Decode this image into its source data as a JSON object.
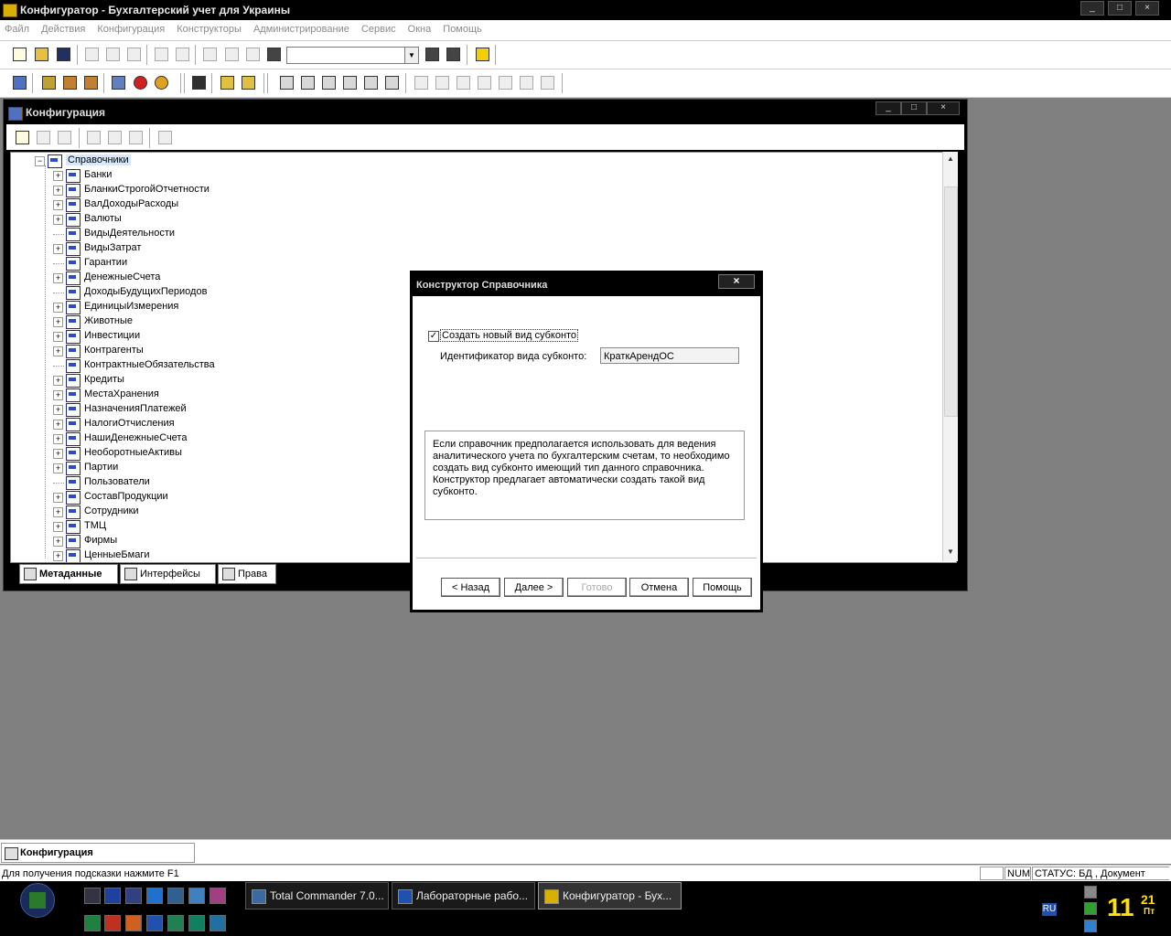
{
  "app": {
    "title": "Конфигуратор - Бухгалтерский учет для Украины"
  },
  "menu": [
    "Файл",
    "Действия",
    "Конфигурация",
    "Конструкторы",
    "Администрирование",
    "Сервис",
    "Окна",
    "Помощь"
  ],
  "config_window": {
    "title": "Конфигурация",
    "tree_root": "Справочники",
    "tree_items": [
      {
        "label": "Банки",
        "expandable": true
      },
      {
        "label": "БланкиСтрогойОтчетности",
        "expandable": true
      },
      {
        "label": "ВалДоходыРасходы",
        "expandable": true
      },
      {
        "label": "Валюты",
        "expandable": true
      },
      {
        "label": "ВидыДеятельности",
        "expandable": false
      },
      {
        "label": "ВидыЗатрат",
        "expandable": true
      },
      {
        "label": "Гарантии",
        "expandable": false
      },
      {
        "label": "ДенежныеСчета",
        "expandable": true
      },
      {
        "label": "ДоходыБудущихПериодов",
        "expandable": false
      },
      {
        "label": "ЕдиницыИзмерения",
        "expandable": true
      },
      {
        "label": "Животные",
        "expandable": true
      },
      {
        "label": "Инвестиции",
        "expandable": true
      },
      {
        "label": "Контрагенты",
        "expandable": true
      },
      {
        "label": "КонтрактныеОбязательства",
        "expandable": false
      },
      {
        "label": "Кредиты",
        "expandable": true
      },
      {
        "label": "МестаХранения",
        "expandable": true
      },
      {
        "label": "НазначенияПлатежей",
        "expandable": true
      },
      {
        "label": "НалогиОтчисления",
        "expandable": true
      },
      {
        "label": "НашиДенежныеСчета",
        "expandable": true
      },
      {
        "label": "НеоборотныеАктивы",
        "expandable": true
      },
      {
        "label": "Партии",
        "expandable": true
      },
      {
        "label": "Пользователи",
        "expandable": false
      },
      {
        "label": "СоставПродукции",
        "expandable": true
      },
      {
        "label": "Сотрудники",
        "expandable": true
      },
      {
        "label": "ТМЦ",
        "expandable": true
      },
      {
        "label": "Фирмы",
        "expandable": true
      },
      {
        "label": "ЦенныеБмаги",
        "expandable": true
      }
    ],
    "tabs": [
      {
        "label": "Метаданные",
        "active": true
      },
      {
        "label": "Интерфейсы",
        "active": false
      },
      {
        "label": "Права",
        "active": false
      }
    ]
  },
  "dialog": {
    "title": "Конструктор Справочника",
    "close_glyph": "×",
    "checkbox_checked": true,
    "checkbox_glyph": "✓",
    "checkbox_label": "Создать новый вид субконто",
    "id_label": "Идентификатор вида субконто:",
    "id_value": "КраткАрендОС",
    "info_text": "Если справочник предполагается использовать для ведения аналитического учета по бухгалтерским счетам, то необходимо создать вид субконто имеющий тип данного справочника. Конструктор предлагает автоматически создать такой вид субконто.",
    "buttons": {
      "back": "< Назад",
      "next": "Далее >",
      "finish": "Готово",
      "cancel": "Отмена",
      "help": "Помощь"
    }
  },
  "window_tab": "Конфигурация",
  "status": {
    "hint": "Для получения подсказки нажмите F1",
    "num": "NUM",
    "state": "СТАТУС: БД , Документ"
  },
  "taskbar": {
    "tasks": [
      {
        "label": "Total Commander 7.0...",
        "active": false
      },
      {
        "label": "Лабораторные рабо...",
        "active": false
      },
      {
        "label": "Конфигуратор - Бух...",
        "active": true
      }
    ],
    "lang": "RU",
    "clock_hour": "11",
    "clock_min": "21",
    "clock_day": "Пт"
  }
}
